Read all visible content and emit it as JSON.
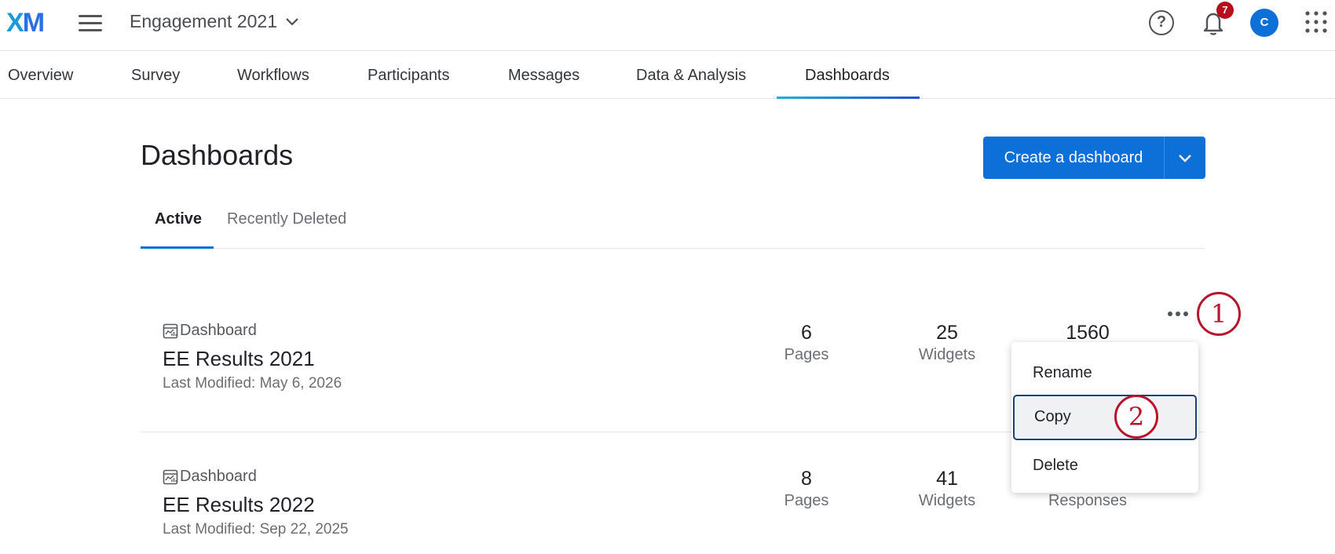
{
  "header": {
    "logo_x": "X",
    "logo_m": "M",
    "project_name": "Engagement 2021",
    "help_glyph": "?",
    "notification_count": "7",
    "avatar_initial": "C"
  },
  "nav": {
    "tabs": [
      {
        "label": "Overview"
      },
      {
        "label": "Survey"
      },
      {
        "label": "Workflows"
      },
      {
        "label": "Participants"
      },
      {
        "label": "Messages"
      },
      {
        "label": "Data & Analysis"
      },
      {
        "label": "Dashboards",
        "active": true
      }
    ]
  },
  "page": {
    "title": "Dashboards",
    "create_button": "Create a dashboard",
    "subtabs": {
      "active": "Active",
      "inactive": "Recently Deleted"
    }
  },
  "dashboards": [
    {
      "type": "Dashboard",
      "name": "EE Results 2021",
      "last_modified": "Last Modified: May 6, 2026",
      "pages": "6",
      "pages_label": "Pages",
      "widgets": "25",
      "widgets_label": "Widgets",
      "responses": "1560"
    },
    {
      "type": "Dashboard",
      "name": "EE Results 2022",
      "last_modified": "Last Modified: Sep 22, 2025",
      "pages": "8",
      "pages_label": "Pages",
      "widgets": "41",
      "widgets_label": "Widgets",
      "responses_label": "Responses"
    }
  ],
  "menu": {
    "items": [
      {
        "label": "Rename"
      },
      {
        "label": "Copy",
        "highlighted": true
      },
      {
        "label": "Delete"
      }
    ]
  },
  "callouts": {
    "one": "1",
    "two": "2"
  },
  "colors": {
    "primary": "#0d6fd8",
    "callout": "#b5162b",
    "badge": "#b50f1a",
    "highlight_border": "#1f3f78"
  }
}
